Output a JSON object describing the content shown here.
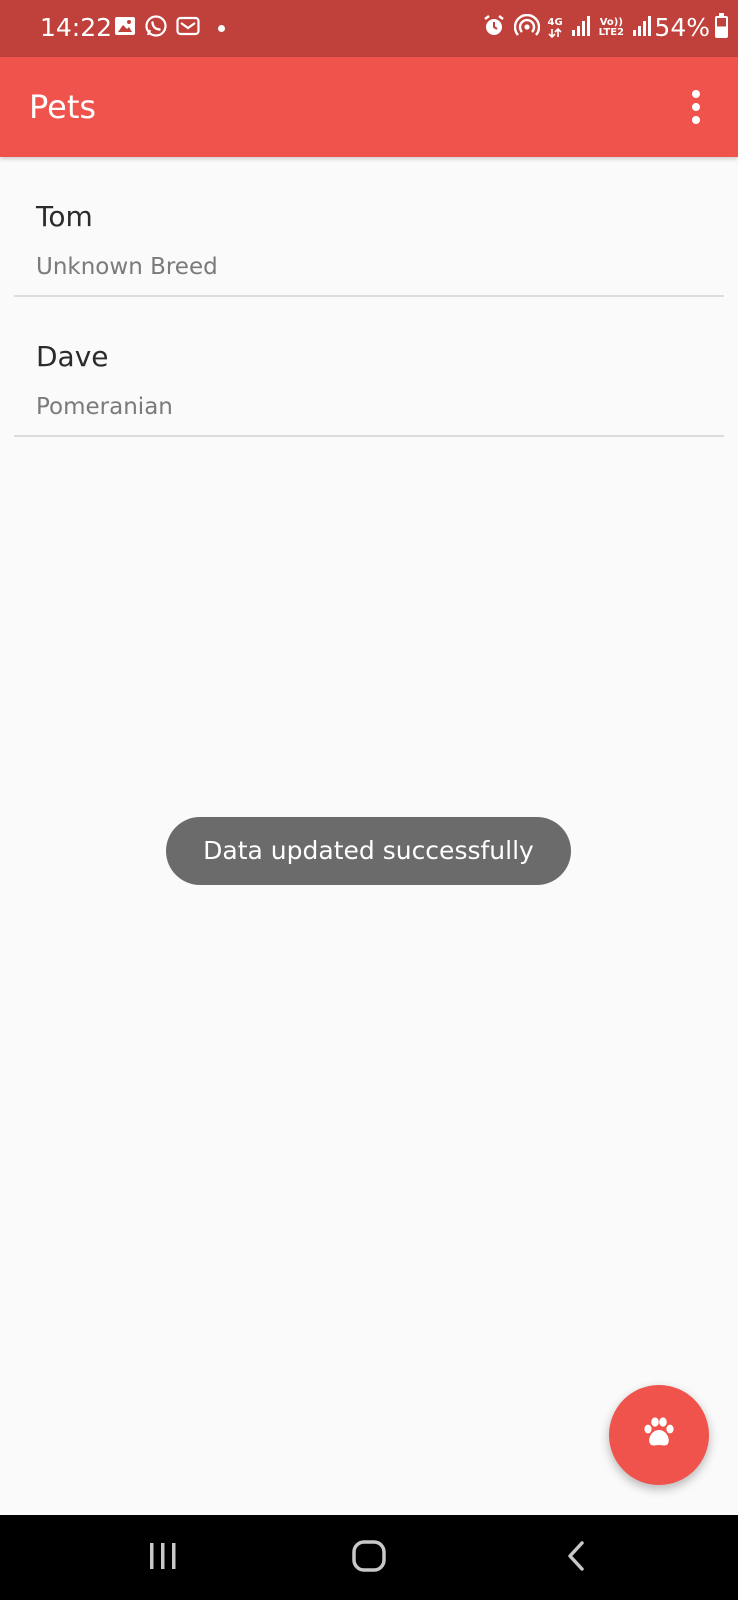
{
  "status_bar": {
    "time": "14:22",
    "network_type": "4G",
    "volte_label": "Vo))",
    "lte_label": "LTE2",
    "battery": "54%",
    "color": "#c0403b"
  },
  "app_bar": {
    "title": "Pets",
    "color": "#f0524c"
  },
  "pets": [
    {
      "name": "Tom",
      "breed": "Unknown Breed"
    },
    {
      "name": "Dave",
      "breed": "Pomeranian"
    }
  ],
  "toast": {
    "message": "Data updated successfully"
  },
  "fab": {
    "icon": "paw-icon"
  },
  "nav_bar": {
    "buttons": [
      "recents-icon",
      "home-icon",
      "back-icon"
    ]
  }
}
